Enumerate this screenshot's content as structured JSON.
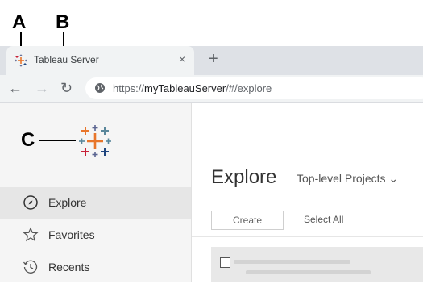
{
  "callouts": {
    "a": "A",
    "b": "B",
    "c": "C"
  },
  "browser": {
    "tab_title": "Tableau Server",
    "tab_close": "×",
    "new_tab": "+",
    "url_prefix": "https://",
    "url_host": "myTableauServer",
    "url_path": "/#/explore",
    "back": "←",
    "forward": "→",
    "reload": "↻"
  },
  "sidebar": {
    "items": [
      {
        "label": "Explore",
        "icon": "compass-icon",
        "active": true
      },
      {
        "label": "Favorites",
        "icon": "star-icon",
        "active": false
      },
      {
        "label": "Recents",
        "icon": "history-icon",
        "active": false
      }
    ]
  },
  "main": {
    "title": "Explore",
    "project_filter": "Top-level Projects ⌄",
    "create_label": "Create",
    "select_all_label": "Select All"
  },
  "colors": {
    "tableau_orange": "#e8762b",
    "tableau_blue": "#5b6591",
    "tableau_red": "#c72037",
    "tableau_navy": "#1f457e",
    "tableau_teal": "#59879b"
  }
}
